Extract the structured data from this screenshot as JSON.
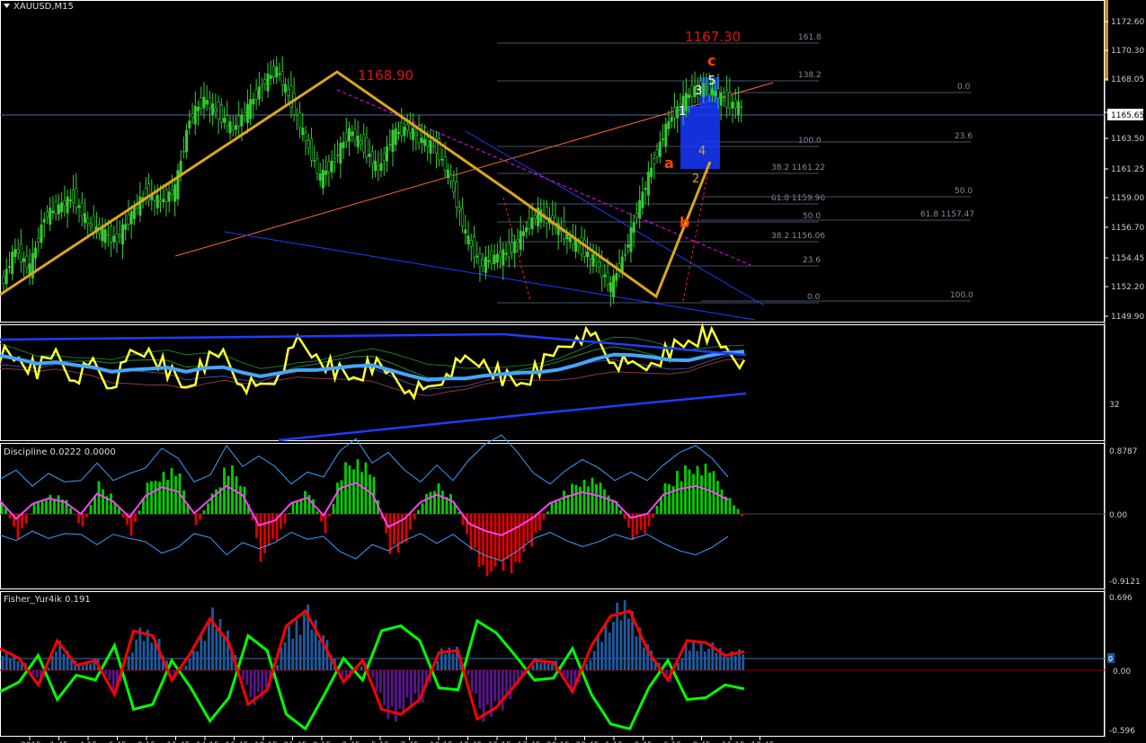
{
  "window": {
    "symbol": "XAUUSD,M15",
    "menu_icon": "triangle-down-icon"
  },
  "colors": {
    "background": "#000000",
    "bull_candle": "#32cd32",
    "frame": "#ffffff",
    "zigzag": "#daa520",
    "wave_label": "#ff4500",
    "fib_line": "#445566",
    "channel": "#1e3cff",
    "discipline_up": "#00d000",
    "discipline_down": "#e00000",
    "fisher_up": "#1e5aa0",
    "fisher_down": "#5a148c",
    "fisher_line_a": "#00ff00",
    "fisher_line_b": "#ff0000"
  },
  "price_panel": {
    "axis_ticks": [
      "1172.60",
      "1170.30",
      "1168.05",
      "1165.65",
      "1163.50",
      "1161.25",
      "1159.00",
      "1156.70",
      "1154.45",
      "1152.20",
      "1149.90"
    ],
    "current_price": "1165.65",
    "annotations": {
      "high_left": "1168.90",
      "target": "1167.30"
    },
    "wave_labels": {
      "a": "a",
      "b": "b",
      "c": "c",
      "n1": "1",
      "n2": "2",
      "n3": "3",
      "n4": "4",
      "n5": "5"
    },
    "fib_levels_left": [
      "161.8",
      "138.2",
      "100.0",
      "38.2 1161.22",
      "61.8 1159.96",
      "50.0",
      "38.2 1156.06",
      "23.6",
      "0.0"
    ],
    "fib_levels_right": [
      "0.0",
      "23.6",
      "50.0",
      "61.8 1157.47",
      "100.0"
    ]
  },
  "rsi_panel": {
    "axis_tick": "32"
  },
  "discipline_panel": {
    "title": "Discipline 0.0222 0.0000",
    "axis_ticks": [
      "0.8787",
      "0.00",
      "-0.9121"
    ]
  },
  "fisher_panel": {
    "title": "Fisher_Yur4ik 0.191",
    "axis_ticks": [
      "0.696",
      "0",
      "0.00",
      "-0.596"
    ]
  },
  "time_axis": {
    "labels": [
      "2015",
      "1:45",
      "4:15",
      "6:45",
      "9:15",
      "11:45",
      "14:15",
      "16:45",
      "19:15",
      "21:45",
      "0:15",
      "2:45",
      "5:15",
      "7:45",
      "10:15",
      "12:45",
      "15:15",
      "17:45",
      "20:15",
      "22:45",
      "1:15",
      "3:45",
      "6:15",
      "8:45",
      "11:15",
      "13:45"
    ]
  },
  "chart_data": [
    {
      "type": "line",
      "title": "XAUUSD,M15",
      "series": [
        {
          "values": [
            1152.5,
            1155.2,
            1153.8,
            1157.6,
            1158.3,
            1159.0,
            1157.1,
            1156.4,
            1155.9,
            1157.8,
            1159.3,
            1158.7,
            1159.6,
            1164.8,
            1166.2,
            1165.1,
            1164.0,
            1165.5,
            1167.3,
            1168.4,
            1166.0,
            1163.2,
            1160.4,
            1161.8,
            1163.9,
            1162.7,
            1161.0,
            1163.6,
            1164.1,
            1163.2,
            1162.6,
            1160.2,
            1156.3,
            1154.1,
            1154.6,
            1155.0,
            1156.5,
            1157.9,
            1157.2,
            1156.1,
            1155.2,
            1154.3,
            1152.4,
            1155.0,
            1158.6,
            1161.8,
            1164.6,
            1166.1,
            1167.2,
            1166.8,
            1166.0,
            1165.6
          ]
        }
      ],
      "ylim": [
        1149.9,
        1173.5
      ]
    },
    {
      "type": "line",
      "series": [
        {
          "values": [
            72,
            66,
            58,
            70,
            55,
            62,
            48,
            66,
            74,
            60,
            45,
            63,
            70,
            52,
            44,
            58,
            76,
            70,
            60,
            52,
            62,
            55,
            48,
            42,
            58,
            62,
            66,
            55,
            48,
            60,
            72,
            86,
            80,
            66,
            58,
            64,
            74,
            78,
            84,
            72,
            66
          ]
        }
      ],
      "ylim": [
        10,
        90
      ]
    },
    {
      "type": "bar",
      "title": "Discipline 0.0222 0.0000",
      "values": [
        0.22,
        -0.35,
        0.12,
        0.3,
        0.18,
        -0.2,
        0.45,
        0.2,
        -0.3,
        0.38,
        0.66,
        0.52,
        -0.18,
        0.28,
        0.7,
        0.4,
        -0.55,
        -0.4,
        0.15,
        0.32,
        -0.25,
        0.62,
        0.8,
        0.45,
        -0.6,
        -0.35,
        0.18,
        0.42,
        0.2,
        -0.5,
        -0.72,
        -0.85,
        -0.6,
        -0.3,
        0.15,
        0.35,
        0.5,
        0.38,
        0.2,
        -0.32,
        -0.2,
        0.42,
        0.6,
        0.7,
        0.52,
        0.25,
        -0.12
      ],
      "ylim": [
        -0.9121,
        0.8787
      ]
    },
    {
      "type": "bar",
      "title": "Fisher_Yur4ik 0.191",
      "values": [
        0.22,
        0.12,
        -0.15,
        0.3,
        0.05,
        0.1,
        -0.25,
        0.4,
        0.35,
        -0.1,
        0.18,
        0.52,
        0.28,
        -0.35,
        -0.2,
        0.45,
        0.6,
        0.25,
        -0.12,
        0.1,
        -0.4,
        -0.45,
        -0.3,
        0.18,
        0.2,
        -0.5,
        -0.38,
        -0.15,
        0.1,
        0.08,
        -0.22,
        0.25,
        0.55,
        0.6,
        0.18,
        -0.1,
        0.3,
        0.28,
        0.15,
        0.19
      ],
      "ylim": [
        -0.596,
        0.696
      ]
    }
  ]
}
